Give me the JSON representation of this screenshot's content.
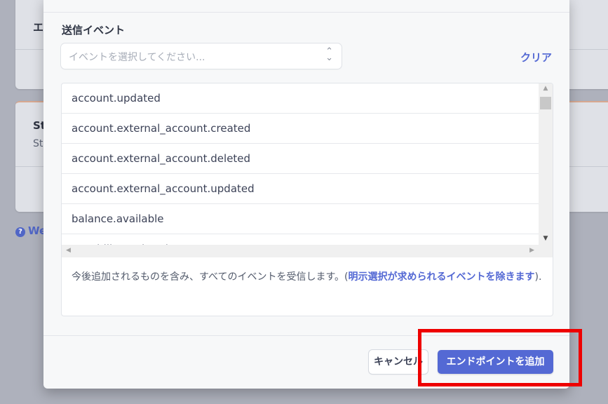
{
  "background": {
    "card1_title": "エ",
    "card2_title": "St",
    "card2_subtitle": "St",
    "help_link": "We"
  },
  "modal": {
    "section_label": "送信イベント",
    "select_placeholder": "イベントを選択してください...",
    "clear_label": "クリア",
    "events": [
      "account.updated",
      "account.external_account.created",
      "account.external_account.deleted",
      "account.external_account.updated",
      "balance.available",
      "capability.updated"
    ],
    "footer_text": "今後追加されるものを含み、すべてのイベントを受信します。(",
    "footer_link": "明示選択が求められるイベントを除きます",
    "footer_end": ").",
    "cancel_label": "キャンセル",
    "add_endpoint_label": "エンドポイントを追加"
  },
  "colors": {
    "accent": "#5469d4",
    "highlight": "#ee0000"
  }
}
